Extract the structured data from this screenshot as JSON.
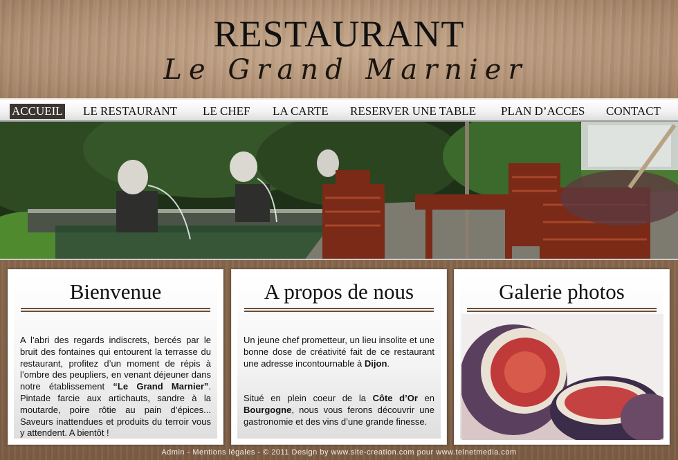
{
  "header": {
    "title": "RESTAURANT",
    "subtitle": "Le Grand Marnier"
  },
  "nav": {
    "items": [
      {
        "label": "ACCUEIL",
        "active": true
      },
      {
        "label": "LE RESTAURANT"
      },
      {
        "label": "LE CHEF"
      },
      {
        "label": "LA CARTE"
      },
      {
        "label": "RESERVER UNE TABLE"
      },
      {
        "label": "PLAN D’ACCES"
      },
      {
        "label": "CONTACT"
      }
    ]
  },
  "panels": {
    "welcome": {
      "title": "Bienvenue",
      "text_1": "A l’abri des regards indiscrets, bercés par le bruit des fontaines qui entourent la terrasse du restaurant, profitez d’un moment de répis à l’ombre des peupliers, en venant déjeuner dans notre établissement ",
      "text_bold": "“Le Grand Marnier”",
      "text_2": ". Pintade farcie aux artichauts, sandre à la moutarde, poire rôtie au pain d’épices... Saveurs inattendues et produits du terroir vous y  attendent. A bientôt !"
    },
    "about": {
      "title": "A propos de nous",
      "p1_text": "Un jeune chef prometteur, un lieu insolite et une bonne dose de créativité fait de ce restaurant une adresse incontournable à ",
      "p1_bold": "Dijon",
      "p1_end": ".",
      "p2_a": "Situé en plein coeur de la ",
      "p2_bold1": "Côte d’Or",
      "p2_b": " en ",
      "p2_bold2": "Bourgogne",
      "p2_c": ", nous vous ferons découvrir une gastronomie et des vins d’une grande finesse."
    },
    "gallery": {
      "title": "Galerie photos"
    }
  },
  "footer": {
    "admin": "Admin",
    "sep1": " - ",
    "legal": "Mentions légales",
    "sep2": " - ",
    "copyright": "©  2011 Design by www.site-creation.com pour www.telnetmedia.com"
  },
  "colors": {
    "nav_active_bg": "#3a3530",
    "rule": "#6a4d38",
    "wood": "#8a6a4f"
  }
}
